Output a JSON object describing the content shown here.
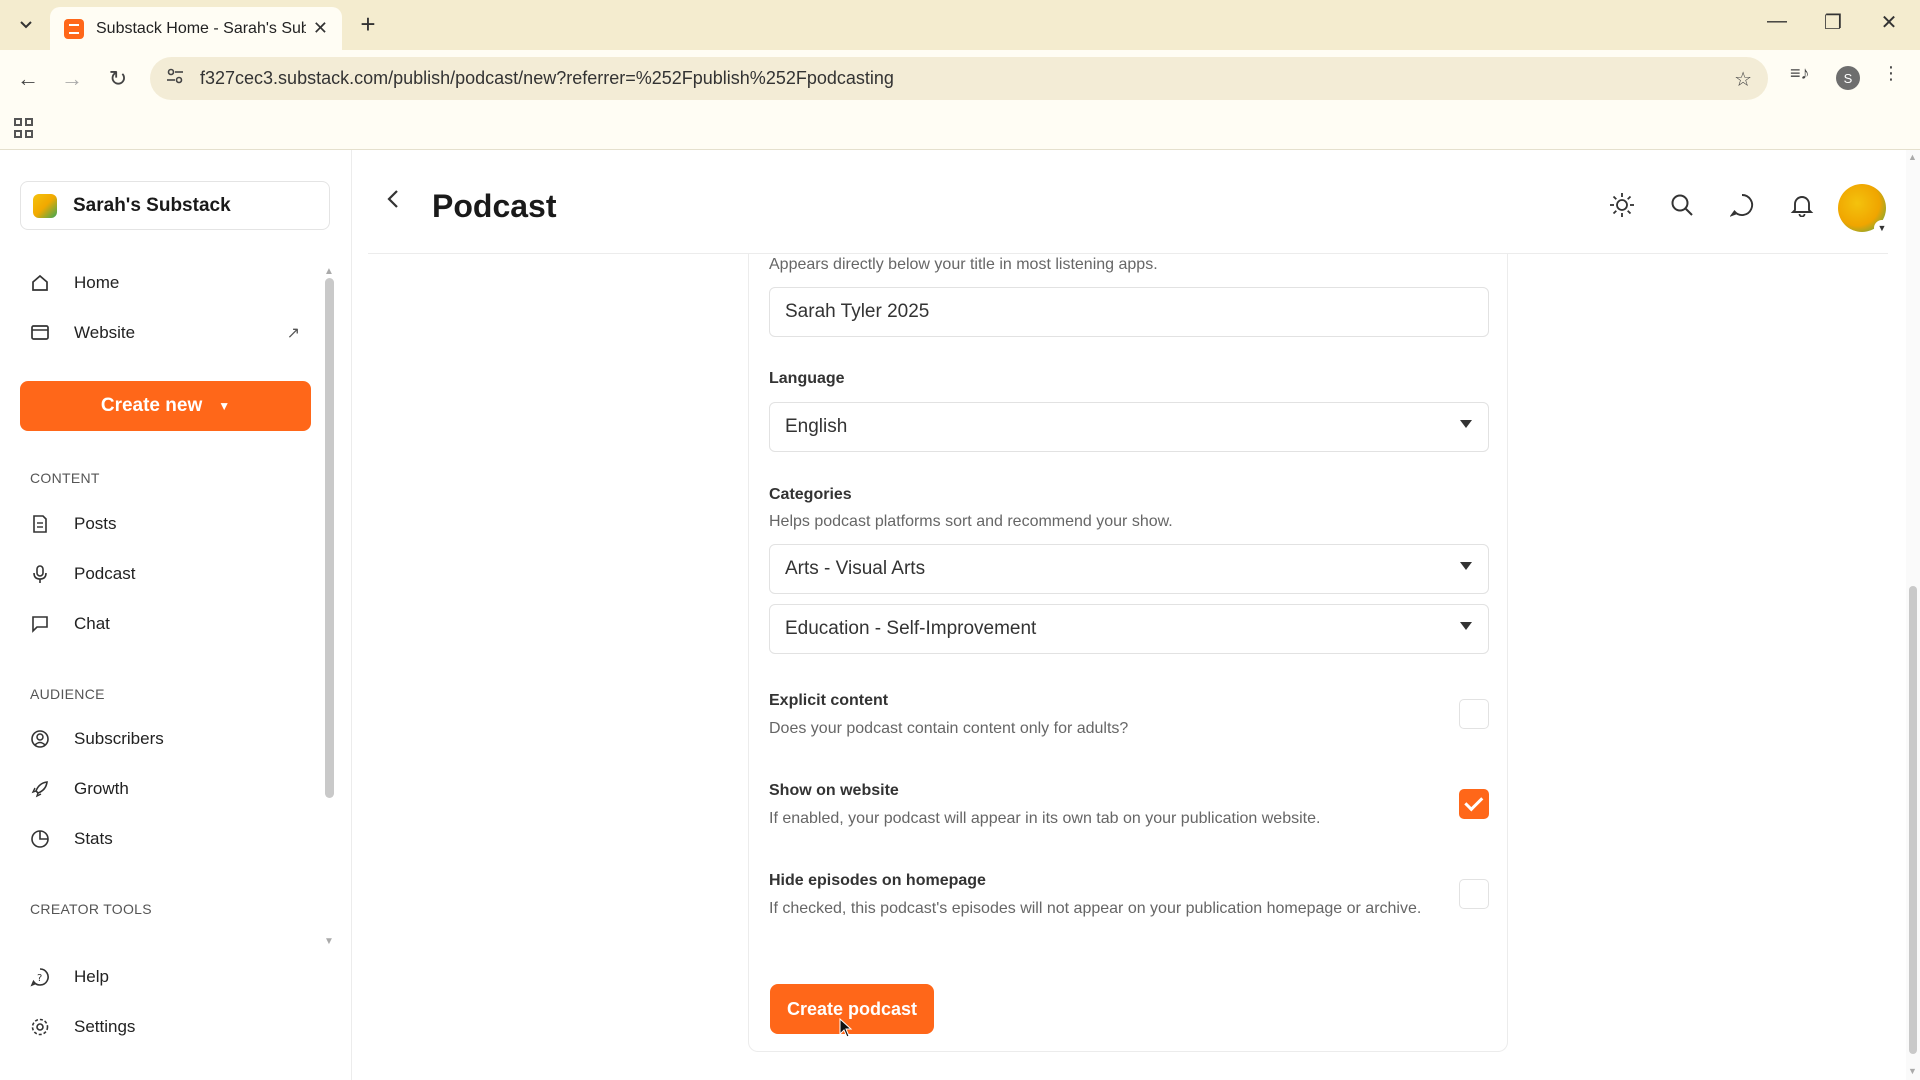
{
  "browser": {
    "tab_title": "Substack Home - Sarah's Substack",
    "url": "f327cec3.substack.com/publish/podcast/new?referrer=%252Fpublish%252Fpodcasting",
    "profile_initial": "S"
  },
  "sidebar": {
    "publication_name": "Sarah's Substack",
    "top_items": [
      {
        "label": "Home",
        "icon": "home-icon"
      },
      {
        "label": "Website",
        "icon": "website-icon"
      }
    ],
    "create_new_label": "Create new",
    "content_section": "CONTENT",
    "content_items": [
      {
        "label": "Posts",
        "icon": "posts-icon"
      },
      {
        "label": "Podcast",
        "icon": "microphone-icon"
      },
      {
        "label": "Chat",
        "icon": "chat-icon"
      }
    ],
    "audience_section": "AUDIENCE",
    "audience_items": [
      {
        "label": "Subscribers",
        "icon": "subscribers-icon"
      },
      {
        "label": "Growth",
        "icon": "rocket-icon"
      },
      {
        "label": "Stats",
        "icon": "stats-icon"
      }
    ],
    "creator_section": "CREATOR TOOLS",
    "bottom_items": [
      {
        "label": "Help",
        "icon": "help-icon"
      },
      {
        "label": "Settings",
        "icon": "gear-icon"
      }
    ]
  },
  "header": {
    "title": "Podcast"
  },
  "form": {
    "author_helper": "Appears directly below your title in most listening apps.",
    "author_value": "Sarah Tyler 2025",
    "language_label": "Language",
    "language_value": "English",
    "categories_label": "Categories",
    "categories_helper": "Helps podcast platforms sort and recommend your show.",
    "category_1": "Arts - Visual Arts",
    "category_2": "Education - Self-Improvement",
    "explicit_label": "Explicit content",
    "explicit_helper": "Does your podcast contain content only for adults?",
    "explicit_checked": false,
    "show_label": "Show on website",
    "show_helper": "If enabled, your podcast will appear in its own tab on your publication website.",
    "show_checked": true,
    "hide_label": "Hide episodes on homepage",
    "hide_helper": "If checked, this podcast's episodes will not appear on your publication homepage or archive.",
    "hide_checked": false,
    "submit_label": "Create podcast"
  },
  "colors": {
    "accent": "#ff6719",
    "chrome": "#f4eccf"
  }
}
